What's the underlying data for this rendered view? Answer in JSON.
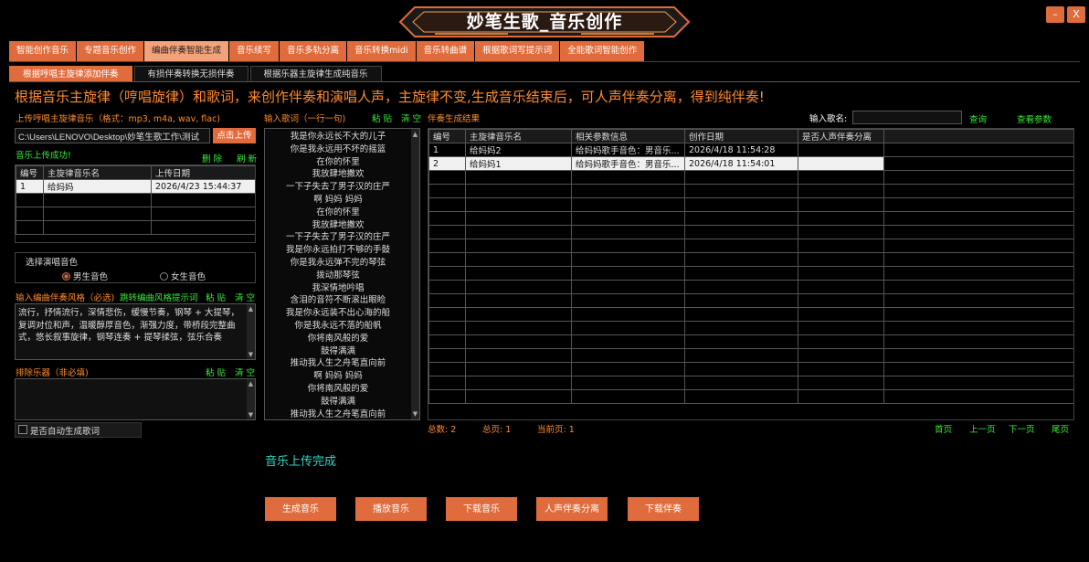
{
  "window": {
    "title": "妙笔生歌_音乐创作",
    "minimize_label": "–",
    "close_label": "X"
  },
  "main_tabs": [
    {
      "label": "智能创作音乐"
    },
    {
      "label": "专题音乐创作"
    },
    {
      "label": "编曲伴奏智能生成",
      "active": true
    },
    {
      "label": "音乐续写"
    },
    {
      "label": "音乐多轨分离"
    },
    {
      "label": "音乐转换midi"
    },
    {
      "label": "音乐转曲谱"
    },
    {
      "label": "根据歌词写提示词"
    },
    {
      "label": "全能歌词智能创作"
    }
  ],
  "sub_tabs": [
    {
      "label": "根据哼唱主旋律添加伴奏",
      "active": true
    },
    {
      "label": "有损伴奏转换无损伴奏"
    },
    {
      "label": "根据乐器主旋律生成纯音乐"
    }
  ],
  "headline": "根据音乐主旋律（哼唱旋律）和歌词，来创作伴奏和演唱人声，主旋律不变,生成音乐结束后，可人声伴奏分离，得到纯伴奏!",
  "upload": {
    "label": "上传哼唱主旋律音乐（格式：mp3, m4a, wav, flac)",
    "path_value": "C:\\Users\\LENOVO\\Desktop\\妙笔生歌工作\\测试",
    "upload_button": "点击上传",
    "success_text": "音乐上传成功!",
    "delete_label": "删 除",
    "refresh_label": "刷 新",
    "table": {
      "headers": [
        "编号",
        "主旋律音乐名",
        "上传日期"
      ],
      "rows": [
        [
          "1",
          "给妈妈",
          "2026/4/23 15:44:37"
        ]
      ]
    }
  },
  "voice": {
    "label": "选择演唱音色",
    "male": "男生音色",
    "female": "女生音色",
    "selected": "male"
  },
  "style": {
    "label": "输入编曲伴奏风格（必选)",
    "hint_link": "跳转编曲风格提示词",
    "paste_label": "粘 贴",
    "clear_label": "清 空",
    "value": "流行，抒情流行，深情悲伤，缓慢节奏，钢琴 + 大提琴，复调对位和声，温暖醇厚音色，渐强力度，带桥段完整曲式，悠长叙事旋律，钢琴连奏 + 提琴揉弦，弦乐合奏"
  },
  "exclude": {
    "label": "排除乐器（非必填)",
    "paste_label": "粘 贴",
    "clear_label": "清 空",
    "value": ""
  },
  "auto_lyrics": {
    "label": "是否自动生成歌词",
    "checked": false
  },
  "lyrics": {
    "label": "输入歌词（一行一句)",
    "paste_label": "粘 贴",
    "clear_label": "清 空",
    "lines": [
      "我是你永远长不大的儿子",
      "你是我永远用不坏的摇篮",
      "在你的怀里",
      "我放肆地撒欢",
      "一下子失去了男子汉的庄严",
      "啊 妈妈 妈妈",
      "在你的怀里",
      "我放肆地撒欢",
      "一下子失去了男子汉的庄严",
      "我是你永远拍打不够的手鼓",
      "你是我永远弹不完的琴弦",
      "拨动那琴弦",
      "我深情地吟唱",
      "含泪的音符不断滚出眼睑",
      "我是你永远装不出心海的船",
      "你是我永远不落的船帆",
      "你将南风般的爱",
      "鼓得满满",
      "推动我人生之舟笔直向前",
      "啊 妈妈 妈妈",
      "你将南风般的爱",
      "鼓得满满",
      "推动我人生之舟笔直向前"
    ]
  },
  "results": {
    "label": "伴奏生成结果",
    "song_name_label": "输入歌名:",
    "song_name_value": "",
    "query_label": "查询",
    "params_label": "查看参数",
    "table": {
      "headers": [
        "编号",
        "主旋律音乐名",
        "相关参数信息",
        "创作日期",
        "是否人声伴奏分离"
      ],
      "rows": [
        [
          "1",
          "给妈妈2",
          "给妈妈歌手音色：男音乐...",
          "2026/4/18 11:54:28",
          ""
        ],
        [
          "2",
          "给妈妈1",
          "给妈妈歌手音色：男音乐...",
          "2026/4/18 11:54:01",
          ""
        ]
      ]
    },
    "pagination": {
      "total_label": "总数:",
      "total": "2",
      "pages_label": "总页:",
      "pages": "1",
      "current_label": "当前页:",
      "current": "1",
      "first": "首页",
      "prev": "上一页",
      "next": "下一页",
      "last": "尾页"
    }
  },
  "status_text": "音乐上传完成",
  "actions": {
    "generate": "生成音乐",
    "play": "播放音乐",
    "download_music": "下载音乐",
    "separate": "人声伴奏分离",
    "download_accompaniment": "下载伴奏"
  },
  "colors": {
    "accent_orange": "#e06b3c",
    "headline_orange": "#ff8a2b",
    "link_green": "#38e838",
    "status_teal": "#2bd6c6"
  }
}
